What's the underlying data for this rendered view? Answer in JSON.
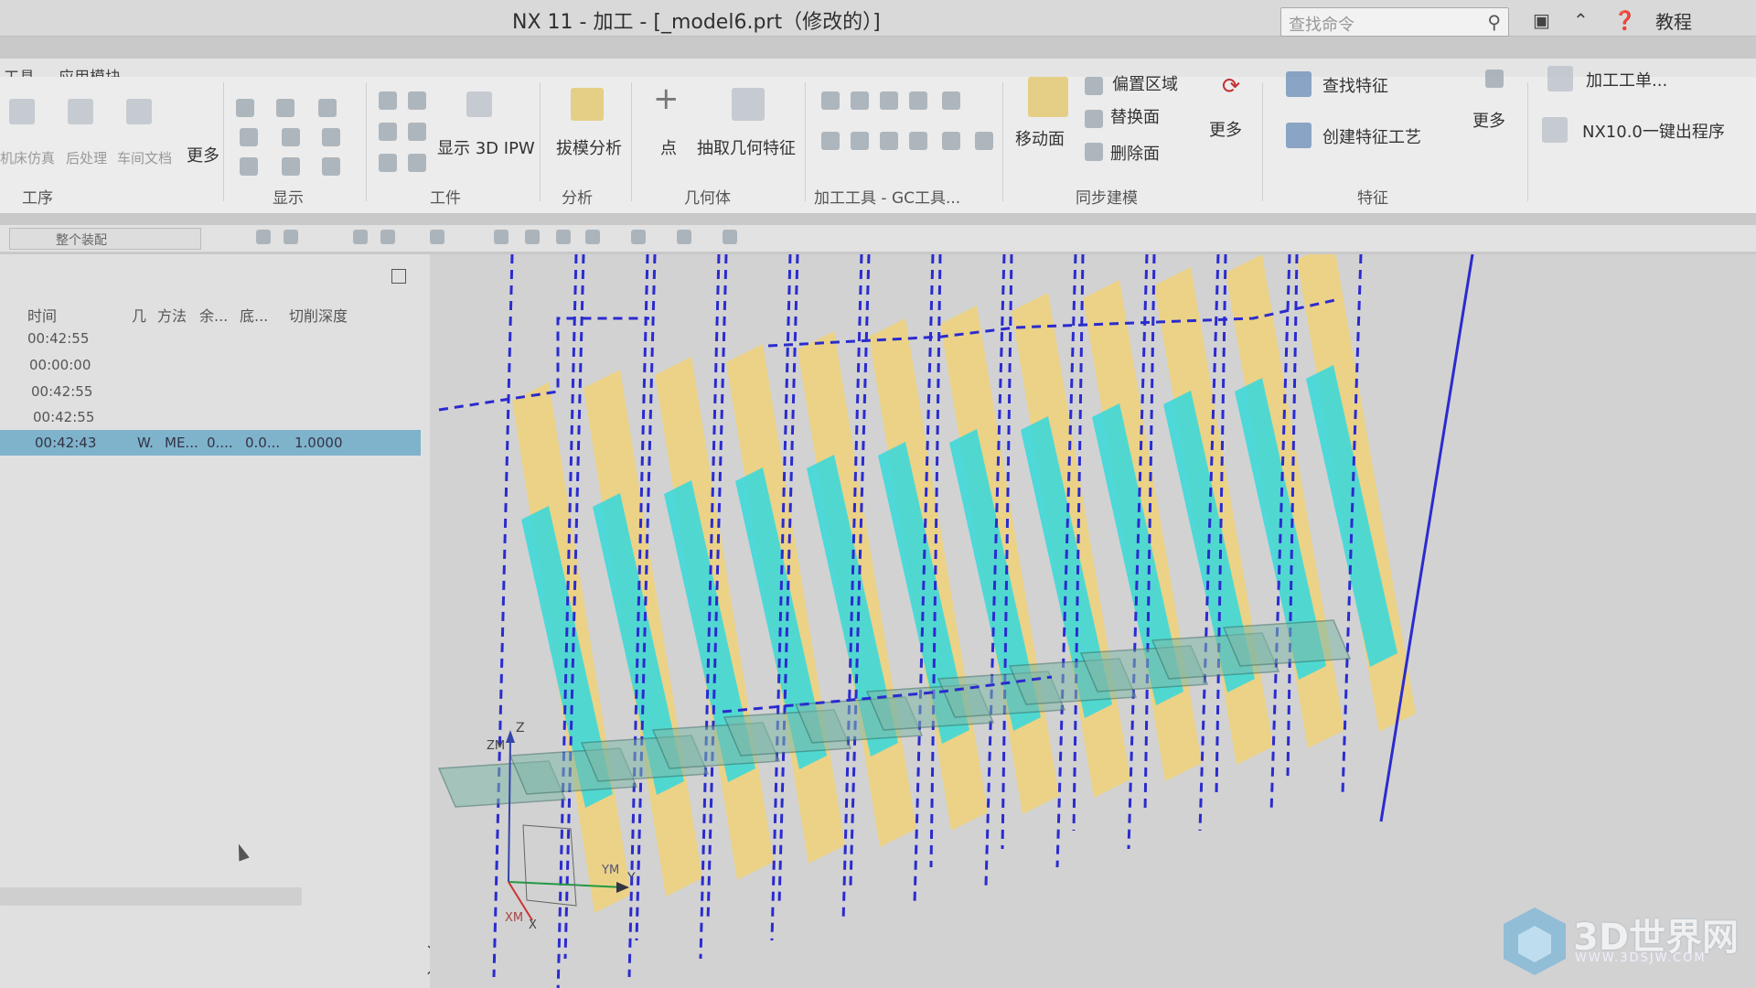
{
  "window": {
    "title": "NX 11 - 加工 - [_model6.prt（修改的）]",
    "search_placeholder": "查找命令",
    "tutorial_label": "教程"
  },
  "menu": {
    "items": [
      "工具",
      "应用模块"
    ]
  },
  "ribbon": {
    "left_labels": [
      "机床仿真",
      "后处理",
      "车间文档",
      "更多"
    ],
    "display_3d_ipw": "显示 3D IPW",
    "draft_analysis": "拔模分析",
    "point": "点",
    "extract_geometry": "抽取几何特征",
    "move_face": "移动面",
    "offset_region": "偏置区域",
    "replace_face": "替换面",
    "delete_face": "删除面",
    "more": "更多",
    "find_feature": "查找特征",
    "create_feature_process": "创建特征工艺",
    "more2": "更多",
    "machining_sheet": "加工工单...",
    "nx10_button": "NX10.0一键出程序",
    "groups": [
      "工序",
      "显示",
      "工件",
      "分析",
      "几何体",
      "加工工具 - GC工具...",
      "同步建模",
      "特征"
    ]
  },
  "quickbar": {
    "filter_value": "整个装配"
  },
  "navigator": {
    "columns": [
      "时间",
      "几",
      "方法",
      "余...",
      "底...",
      "切削深度"
    ],
    "rows": [
      {
        "time": "00:42:55"
      },
      {
        "time": "00:00:00"
      },
      {
        "time": "00:42:55"
      },
      {
        "time": "00:42:55"
      },
      {
        "time": "00:42:43",
        "geom": "W.",
        "method": "ME...",
        "stock": "0....",
        "floor": "0.0...",
        "depth": "1.0000",
        "selected": true
      }
    ]
  },
  "axes": {
    "z": "Z",
    "zm": "ZM",
    "ym": "YM",
    "y": "Y",
    "xm": "XM",
    "x": "X"
  },
  "watermark": {
    "brand": "3D世界网",
    "url": "WWW.3DSJW.COM"
  },
  "colors": {
    "toolpath_dash": "#2b2bcf",
    "stripe_yellow": "#f0d27a",
    "stripe_cyan": "#3fd8d8",
    "plane_green": "#7fb8a8",
    "selected_row": "#7fb3cc"
  }
}
